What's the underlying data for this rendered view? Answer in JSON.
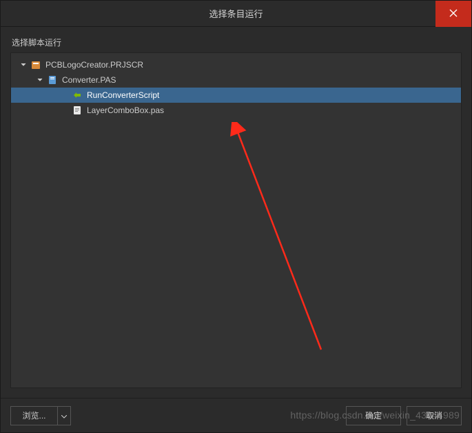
{
  "dialog": {
    "title": "选择条目运行",
    "section_label": "选择脚本运行"
  },
  "tree": {
    "items": [
      {
        "label": "PCBLogoCreator.PRJSCR",
        "level": 1,
        "icon": "project",
        "expanded": true
      },
      {
        "label": "Converter.PAS",
        "level": 2,
        "icon": "source",
        "expanded": true
      },
      {
        "label": "RunConverterScript",
        "level": 3,
        "icon": "method",
        "selected": true
      },
      {
        "label": "LayerComboBox.pas",
        "level": 3,
        "icon": "file"
      }
    ]
  },
  "buttons": {
    "browse": "浏览...",
    "ok": "确定",
    "cancel": "取消"
  },
  "watermark": "https://blog.csdn.net/weixin_43444989"
}
